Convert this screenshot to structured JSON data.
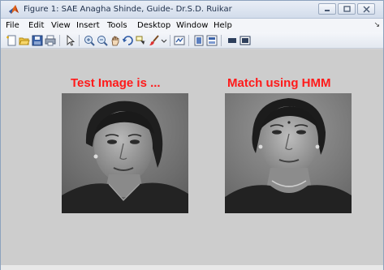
{
  "window": {
    "title": "Figure 1: SAE Anagha Shinde, Guide- Dr.S.D. Ruikar",
    "controls": [
      "minimize",
      "maximize",
      "close"
    ]
  },
  "menu": {
    "items": [
      "File",
      "Edit",
      "View",
      "Insert",
      "Tools",
      "Desktop",
      "Window",
      "Help"
    ]
  },
  "toolbar": {
    "icons": [
      "new-figure-icon",
      "open-file-icon",
      "save-icon",
      "print-icon",
      "edit-plot-icon",
      "zoom-in-icon",
      "zoom-out-icon",
      "pan-icon",
      "rotate-3d-icon",
      "data-cursor-icon",
      "brush-icon",
      "link-plot-icon",
      "colorbar-icon",
      "legend-icon",
      "hide-plot-tools-icon",
      "show-plot-tools-icon"
    ]
  },
  "figure": {
    "left_title": "Test Image is ...",
    "right_title": "Match using HMM",
    "title_color": "#ff1a1a",
    "background": "#cdcdcd"
  }
}
